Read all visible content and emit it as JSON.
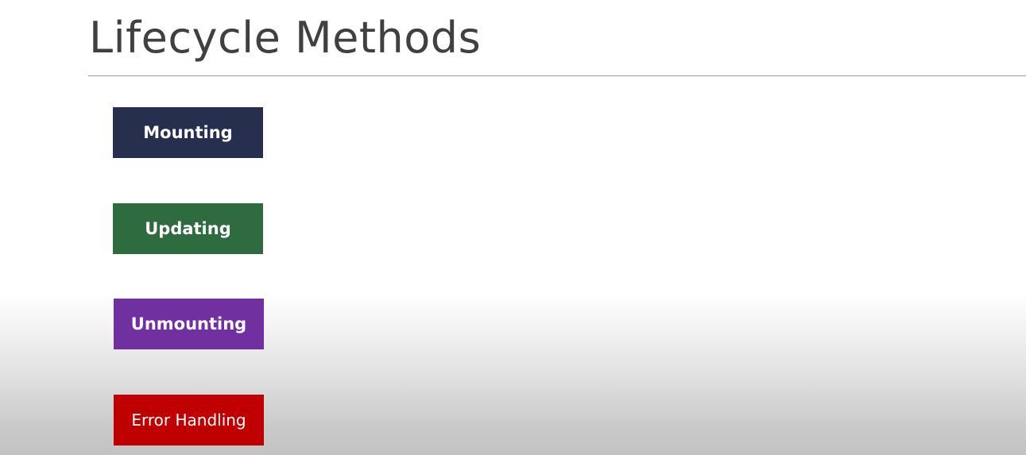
{
  "slide": {
    "title": "Lifecycle Methods"
  },
  "phases": [
    {
      "label": "Mounting",
      "color": "#262f4e"
    },
    {
      "label": "Updating",
      "color": "#2e6b3f"
    },
    {
      "label": "Unmounting",
      "color": "#7030a0"
    },
    {
      "label": "Error Handling",
      "color": "#c00000"
    }
  ]
}
